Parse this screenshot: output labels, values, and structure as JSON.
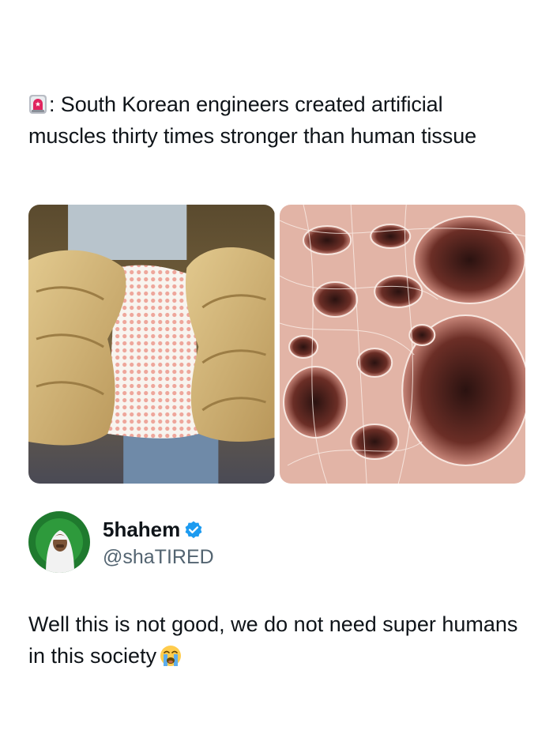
{
  "quoted_post": {
    "emoji_icon": "police-car-light-icon",
    "text": ": South Korean engineers created artificial muscles thirty times stronger than human tissue"
  },
  "media": {
    "images": [
      {
        "name": "hands-stretching-mesh-image"
      },
      {
        "name": "porous-fibrous-tissue-image"
      }
    ]
  },
  "author": {
    "display_name": "5hahem",
    "handle": "@shaTIRED",
    "verified_color": "#1d9bf0",
    "avatar_background": "#1f7a2e"
  },
  "reply": {
    "text": "Well this is not good, we do not need super humans in this society",
    "emoji_icon": "loudly-crying-face-icon"
  }
}
